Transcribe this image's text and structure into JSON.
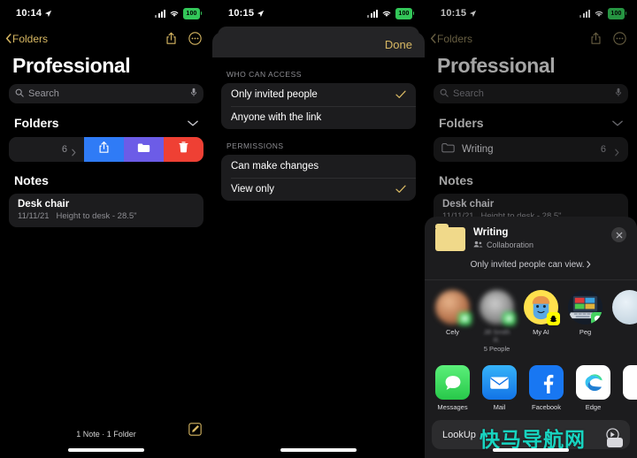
{
  "panels": [
    {
      "id": "notes-folder-swipe",
      "status": {
        "time": "10:14",
        "battery": "100",
        "location_icon": "location-arrow-icon",
        "wifi_icon": "wifi-icon",
        "signal_icon": "cellular-bars-icon"
      },
      "nav": {
        "back_label": "Folders",
        "share_icon": "share-icon",
        "more_icon": "more-ellipsis-icon"
      },
      "title": "Professional",
      "search": {
        "placeholder": "Search",
        "icon": "search-icon",
        "mic_icon": "microphone-icon"
      },
      "folders_section": {
        "title": "Folders",
        "collapse_icon": "chevron-down-icon"
      },
      "swipe_row": {
        "count": "6",
        "chevron_icon": "chevron-right-icon",
        "actions": [
          {
            "name": "share",
            "icon": "share-icon",
            "color": "#2f7bf6"
          },
          {
            "name": "move",
            "icon": "folder-icon",
            "color": "#6c5ce7"
          },
          {
            "name": "delete",
            "icon": "trash-icon",
            "color": "#ef4034"
          }
        ]
      },
      "notes_section": {
        "title": "Notes"
      },
      "note": {
        "title": "Desk chair",
        "date": "11/11/21",
        "preview": "Height to desk - 28.5\""
      },
      "footer": {
        "text": "1 Note · 1 Folder",
        "compose_icon": "compose-icon"
      }
    },
    {
      "id": "permissions-sheet",
      "status": {
        "time": "10:15",
        "battery": "100"
      },
      "done_label": "Done",
      "groups": [
        {
          "label": "WHO CAN ACCESS",
          "rows": [
            {
              "label": "Only invited people",
              "checked": true
            },
            {
              "label": "Anyone with the link",
              "checked": false
            }
          ]
        },
        {
          "label": "PERMISSIONS",
          "rows": [
            {
              "label": "Can make changes",
              "checked": false
            },
            {
              "label": "View only",
              "checked": true
            }
          ]
        }
      ]
    },
    {
      "id": "share-sheet",
      "status": {
        "time": "10:15",
        "battery": "100"
      },
      "nav": {
        "back_label": "Folders",
        "share_icon": "share-icon",
        "more_icon": "more-ellipsis-icon"
      },
      "title": "Professional",
      "search": {
        "placeholder": "Search"
      },
      "folders_section": {
        "title": "Folders",
        "collapse_icon": "chevron-down-icon"
      },
      "folder_row": {
        "icon": "folder-icon",
        "label": "Writing",
        "count": "6",
        "chevron_icon": "chevron-right-icon"
      },
      "notes_section": {
        "title": "Notes"
      },
      "note": {
        "title": "Desk chair",
        "date": "11/11/21",
        "preview": "Height to desk - 28.5\""
      },
      "sheet": {
        "folder_icon": "folder-icon",
        "title": "Writing",
        "subtitle": "Collaboration",
        "subtitle_icon": "people-icon",
        "access_text": "Only invited people can view.",
        "access_chevron": "chevron-right-icon",
        "close_icon": "close-icon",
        "contacts": [
          {
            "name": "Cely",
            "badge": "messages-icon",
            "sub": ""
          },
          {
            "name": "Jill Smith R.",
            "badge": "messages-icon",
            "sub": "5 People",
            "blurred": true
          },
          {
            "name": "My AI",
            "badge": "snapchat-icon",
            "sub": ""
          },
          {
            "name": "Peg",
            "badge": "messages-icon",
            "sub": ""
          },
          {
            "name": "",
            "badge": "",
            "sub": ""
          }
        ],
        "apps": [
          {
            "name": "Messages",
            "icon": "messages-app-icon",
            "color": "#4cd964"
          },
          {
            "name": "Mail",
            "icon": "mail-app-icon",
            "color": "#1f8ef1"
          },
          {
            "name": "Facebook",
            "icon": "facebook-app-icon",
            "color": "#1877f2"
          },
          {
            "name": "Edge",
            "icon": "edge-app-icon",
            "color": "#ffffff"
          },
          {
            "name": "",
            "icon": "",
            "color": "#3a3a3c"
          }
        ],
        "lookup": {
          "label": "LookUp",
          "icon": "lookup-icon"
        }
      },
      "watermark": "快马导航网"
    }
  ]
}
